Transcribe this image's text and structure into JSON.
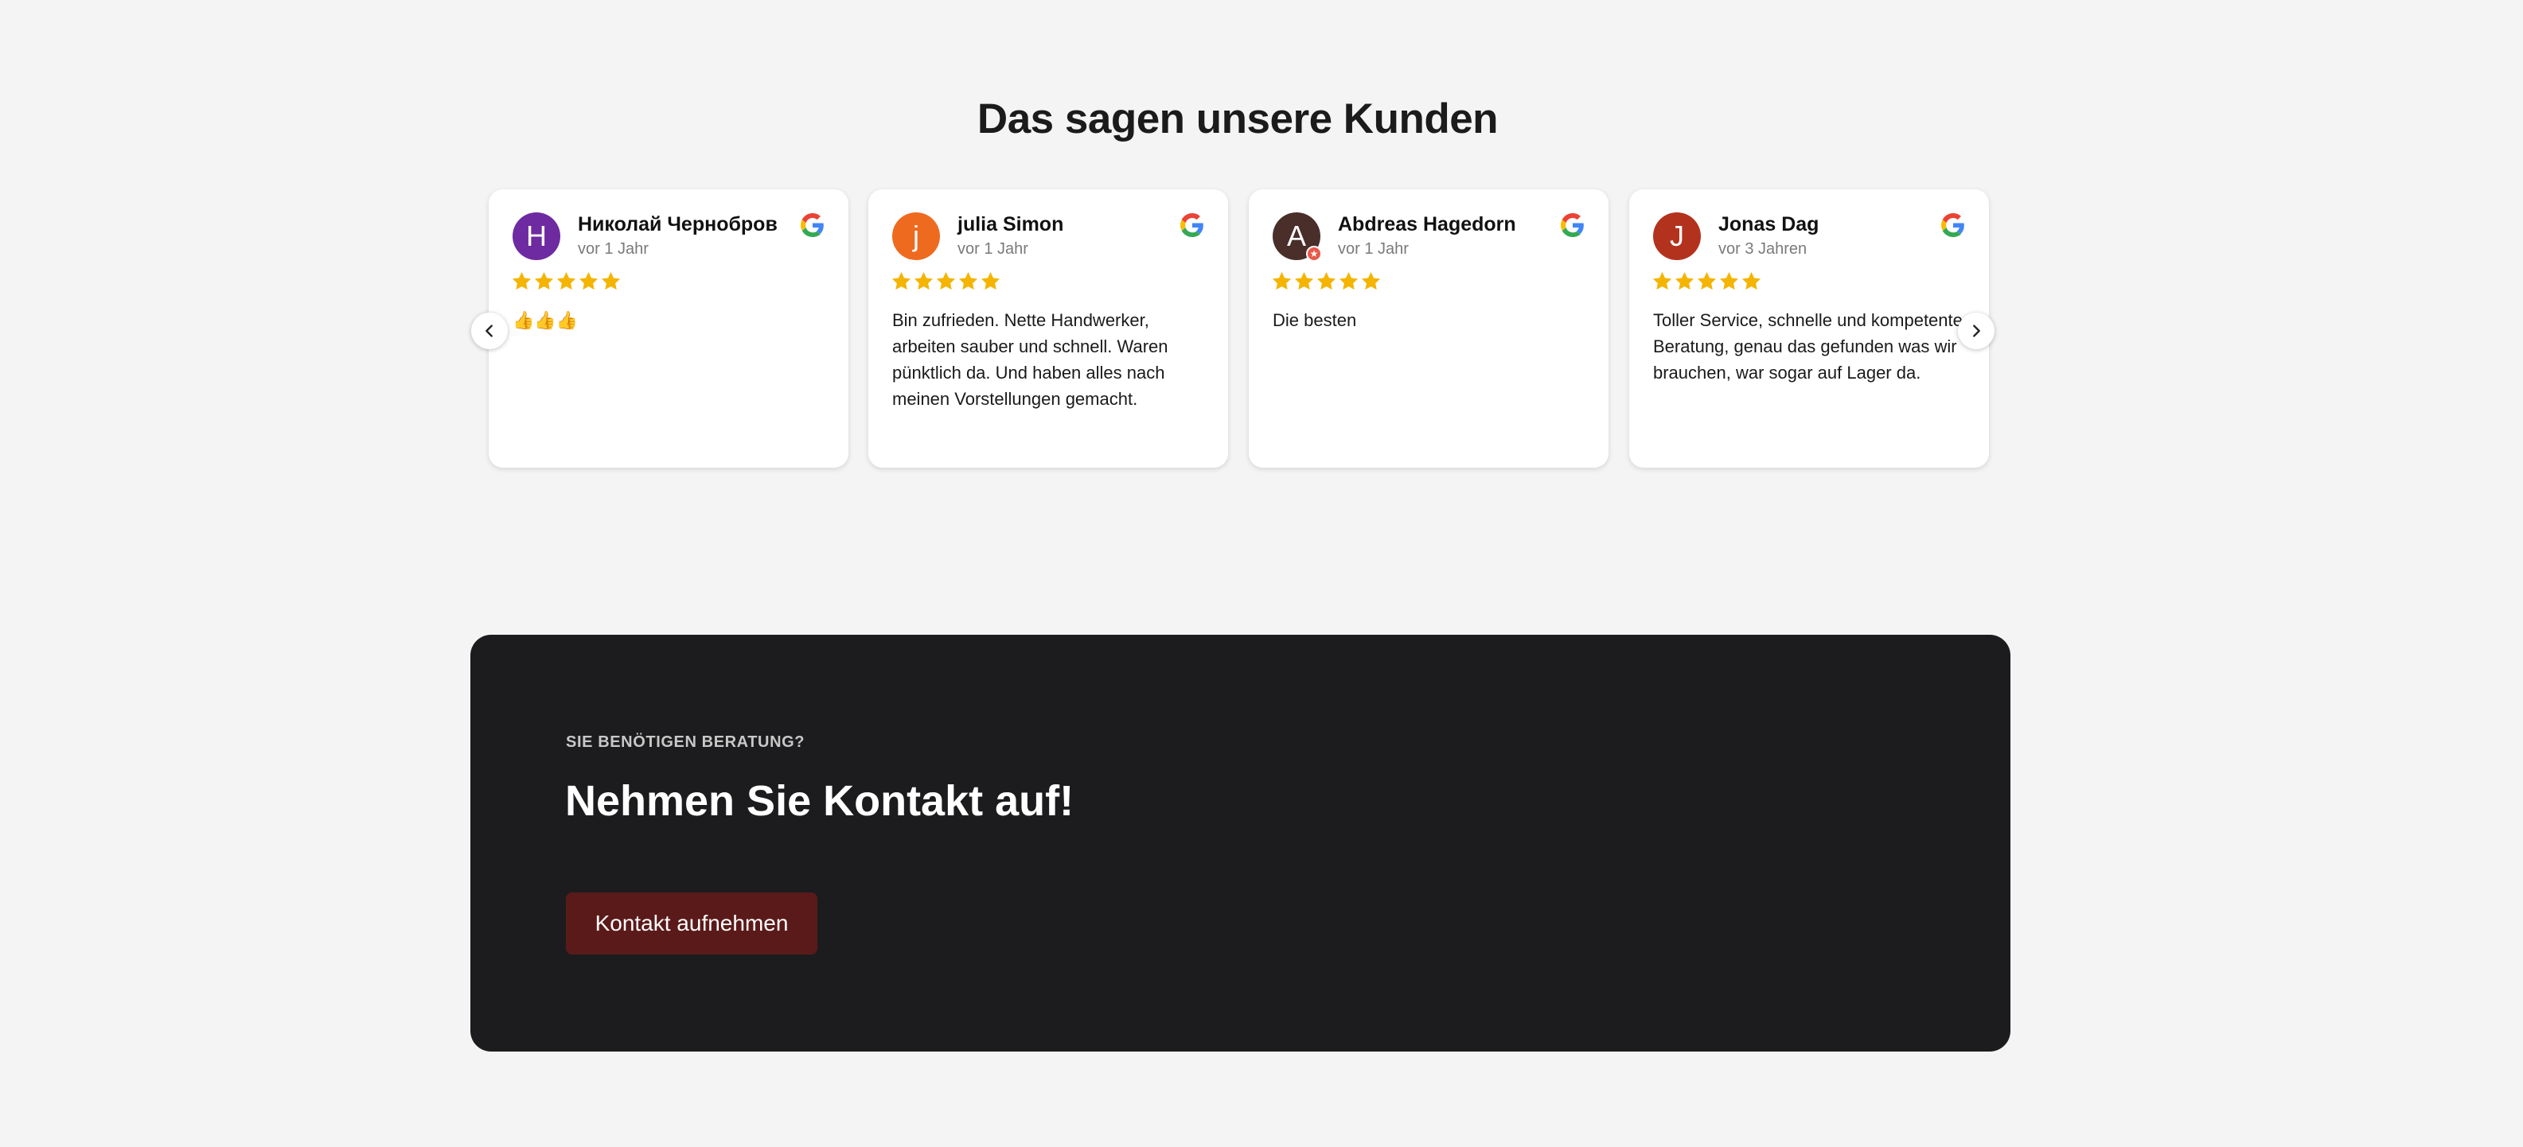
{
  "reviews_section": {
    "title": "Das sagen unsere Kunden",
    "reviews": [
      {
        "initial": "H",
        "avatar_color": "#6e2aa0",
        "name": "Николай Чернобров",
        "date": "vor 1 Jahr",
        "rating": 5,
        "text": "👍👍👍",
        "source_icon": "google-icon"
      },
      {
        "initial": "j",
        "avatar_color": "#ee6a1f",
        "name": "julia Simon",
        "date": "vor 1 Jahr",
        "rating": 5,
        "text": "Bin zufrieden. Nette Handwerker, arbeiten sauber und schnell. Waren pünktlich da. Und haben alles nach meinen Vorstellungen gemacht.",
        "source_icon": "google-icon"
      },
      {
        "initial": "A",
        "avatar_color": "#4a2e2a",
        "name": "Abdreas Hagedorn",
        "date": "vor 1 Jahr",
        "rating": 5,
        "text": "Die besten",
        "source_icon": "google-icon"
      },
      {
        "initial": "J",
        "avatar_color": "#b3321e",
        "name": "Jonas Dag",
        "date": "vor 3 Jahren",
        "rating": 5,
        "text": "Toller Service, schnelle und kompetente Beratung, genau das gefunden was wir brauchen, war sogar auf Lager da.",
        "source_icon": "google-icon"
      }
    ],
    "prev_icon": "chevron-left-icon",
    "next_icon": "chevron-right-icon",
    "star_color": "#f4b400"
  },
  "cta": {
    "eyebrow": "SIE BENÖTIGEN BERATUNG?",
    "title": "Nehmen Sie Kontakt auf!",
    "button_label": "Kontakt aufnehmen",
    "background_color": "#1c1c1e",
    "button_color": "#5b1a1a"
  }
}
